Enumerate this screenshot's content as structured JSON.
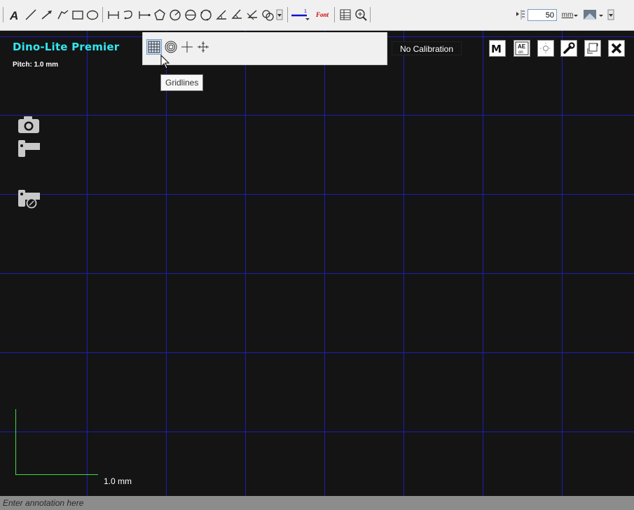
{
  "toolbar": {
    "scale_value": "50",
    "unit_label": "mm",
    "font_label": "Font",
    "tools": [
      "text-tool",
      "line-tool",
      "arrow-tool",
      "freehand-line-tool",
      "rectangle-tool",
      "ellipse-tool",
      "dimension-line-tool",
      "arc-measure-tool",
      "parallel-lines-tool",
      "polygon-tool",
      "circle-tool",
      "diameter-circle-tool",
      "three-point-circle-tool",
      "angle-tool",
      "three-point-angle-tool",
      "four-point-angle-tool",
      "center-distance-tool",
      "line-color-picker",
      "font-picker",
      "table-icon",
      "zoom-icon",
      "scale-spin",
      "unit-selector",
      "color-dropdown"
    ]
  },
  "viewer": {
    "device_name": "Dino-Lite Premier",
    "pitch": "Pitch: 1.0 mm",
    "calibration": "No Calibration",
    "scale_bar_label": "1.0 mm",
    "grid_color": "#1d1db8",
    "scale_bar_color": "#3ddc3d"
  },
  "grid_popup": {
    "options": [
      "gridlines",
      "concentric-circles",
      "crosshair",
      "crosshair-ticks"
    ],
    "tooltip": "Gridlines"
  },
  "annotation": {
    "placeholder": "Enter annotation here"
  }
}
